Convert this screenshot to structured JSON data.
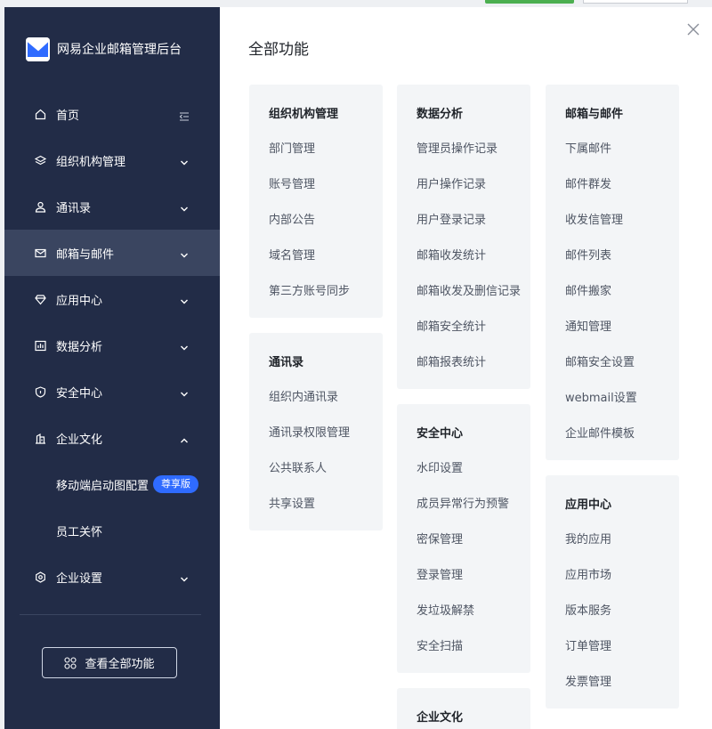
{
  "brand": {
    "name": "网易企业邮箱管理后台"
  },
  "sidebar": {
    "items": [
      {
        "label": "首页",
        "icon": "home-icon"
      },
      {
        "label": "组织机构管理",
        "icon": "layers-icon"
      },
      {
        "label": "通讯录",
        "icon": "user-icon"
      },
      {
        "label": "邮箱与邮件",
        "icon": "mail-icon"
      },
      {
        "label": "应用中心",
        "icon": "diamond-icon"
      },
      {
        "label": "数据分析",
        "icon": "bar-chart-icon"
      },
      {
        "label": "安全中心",
        "icon": "shield-icon"
      },
      {
        "label": "企业文化",
        "icon": "building-icon"
      },
      {
        "label": "企业设置",
        "icon": "settings-icon"
      }
    ],
    "subitems": [
      {
        "label": "移动端启动图配置",
        "badge": "尊享版"
      },
      {
        "label": "员工关怀"
      }
    ],
    "view_all": "查看全部功能"
  },
  "panel": {
    "title": "全部功能",
    "cards": [
      {
        "title": "组织机构管理",
        "items": [
          "部门管理",
          "账号管理",
          "内部公告",
          "域名管理",
          "第三方账号同步"
        ]
      },
      {
        "title": "通讯录",
        "items": [
          "组织内通讯录",
          "通讯录权限管理",
          "公共联系人",
          "共享设置"
        ]
      },
      {
        "title": "数据分析",
        "items": [
          "管理员操作记录",
          "用户操作记录",
          "用户登录记录",
          "邮箱收发统计",
          "邮箱收发及删信记录",
          "邮箱安全统计",
          "邮箱报表统计"
        ]
      },
      {
        "title": "安全中心",
        "items": [
          "水印设置",
          "成员异常行为预警",
          "密保管理",
          "登录管理",
          "发垃圾解禁",
          "安全扫描"
        ]
      },
      {
        "title": "企业文化",
        "items": []
      },
      {
        "title": "邮箱与邮件",
        "items": [
          "下属邮件",
          "邮件群发",
          "收发信管理",
          "邮件列表",
          "邮件搬家",
          "通知管理",
          "邮箱安全设置",
          "webmail设置",
          "企业邮件模板"
        ]
      },
      {
        "title": "应用中心",
        "items": [
          "我的应用",
          "应用市场",
          "版本服务",
          "订单管理",
          "发票管理"
        ]
      }
    ]
  },
  "colors": {
    "sidebar_bg": "#222c47",
    "sidebar_active": "#3a4560",
    "badge": "#2f6bff",
    "card_bg": "#f3f5f7"
  }
}
